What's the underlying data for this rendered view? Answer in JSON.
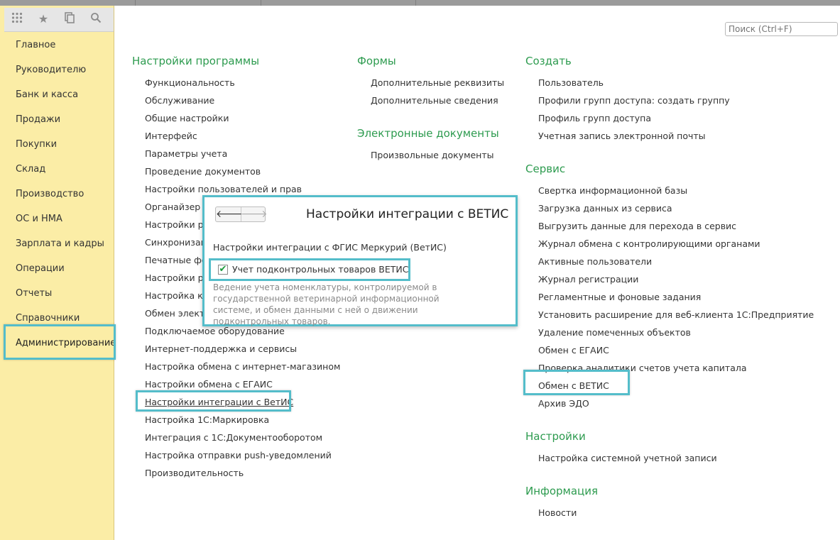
{
  "search": {
    "placeholder": "Поиск (Ctrl+F)"
  },
  "toolbar_icons": [
    "apps-grid-icon",
    "star-icon",
    "history-icon",
    "search-icon"
  ],
  "sections": [
    "Главное",
    "Руководителю",
    "Банк и касса",
    "Продажи",
    "Покупки",
    "Склад",
    "Производство",
    "ОС и НМА",
    "Зарплата и кадры",
    "Операции",
    "Отчеты",
    "Справочники",
    "Администрирование"
  ],
  "active_section": "Администрирование",
  "col1": {
    "title": "Настройки программы",
    "links": [
      "Функциональность",
      "Обслуживание",
      "Общие настройки",
      "Интерфейс",
      "Параметры учета",
      "Проведение документов",
      "Настройки пользователей и прав",
      "Органайзер",
      "Настройки ра",
      "Синхронизаци",
      "Печатные фо",
      "Настройки ре",
      "Настройка ко",
      "Обмен элект",
      "Подключаемое оборудование",
      "Интернет-поддержка и сервисы",
      "Настройка обмена с интернет-магазином",
      "Настройки обмена с ЕГАИС",
      "Настройки интеграции с ВетИС",
      "Настройка 1С:Маркировка",
      "Интеграция с 1С:Документооборотом",
      "Настройка отправки push-уведомлений",
      "Производительность"
    ]
  },
  "col2": {
    "groups": [
      {
        "title": "Формы",
        "links": [
          "Дополнительные реквизиты",
          "Дополнительные сведения"
        ]
      },
      {
        "title": "Электронные документы",
        "links": [
          "Произвольные документы"
        ]
      }
    ]
  },
  "col3": {
    "groups": [
      {
        "title": "Создать",
        "links": [
          "Пользователь",
          "Профили групп доступа: создать группу",
          "Профиль групп доступа",
          "Учетная запись электронной почты"
        ]
      },
      {
        "title": "Сервис",
        "links": [
          "Свертка информационной базы",
          "Загрузка данных из сервиса",
          "Выгрузить данные для перехода в сервис",
          "Журнал обмена с контролирующими органами",
          "Активные пользователи",
          "Журнал регистрации",
          "Регламентные и фоновые задания",
          "Установить расширение для веб-клиента 1С:Предприятие",
          "Удаление помеченных объектов",
          "Обмен с ЕГАИС",
          "Проверка аналитики счетов учета капитала",
          "Обмен с ВЕТИС",
          "Архив ЭДО"
        ]
      },
      {
        "title": "Настройки",
        "links": [
          "Настройка системной учетной записи"
        ]
      },
      {
        "title": "Информация",
        "links": [
          "Новости"
        ]
      }
    ]
  },
  "popup": {
    "title": "Настройки интеграции с ВЕТИС",
    "back_icon": "arrow-left-icon",
    "forward_icon": "arrow-right-icon",
    "subtitle": "Настройки интеграции с ФГИС Меркурий (ВетИС)",
    "checkbox_label": "Учет подконтрольных товаров ВЕТИС",
    "checkbox_checked": true,
    "description": "Ведение учета номенклатуры, контролируемой в государственной ветеринарной информационной системе, и обмен данными с ней о движении подконтрольных товаров."
  }
}
